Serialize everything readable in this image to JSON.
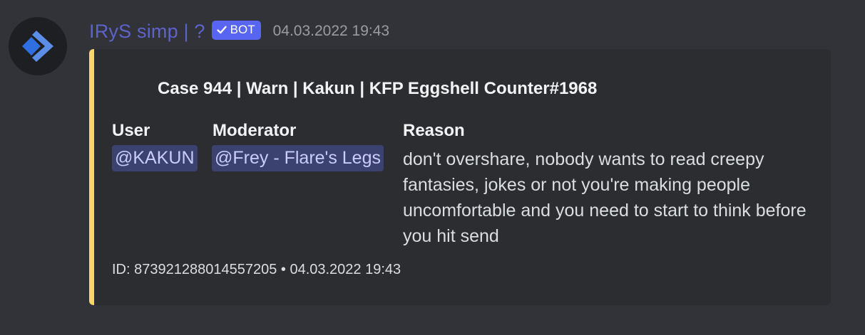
{
  "author": {
    "username": "IRyS simp | ?",
    "badge_label": "BOT",
    "timestamp": "04.03.2022 19:43",
    "avatar_icon": "chevron-right-diamond-icon"
  },
  "embed": {
    "accent_color": "#f8d864",
    "title": "Case 944 | Warn | Kakun | KFP Eggshell Counter#1968",
    "fields": {
      "user": {
        "name": "User",
        "value": "@KAKUN"
      },
      "moderator": {
        "name": "Moderator",
        "value": "@Frey - Flare's Legs"
      },
      "reason": {
        "name": "Reason",
        "value": "don't overshare, nobody wants to read creepy fantasies, jokes or not you're making people uncomfortable and you need to start to think before you hit send"
      }
    },
    "footer": "ID: 873921288014557205 • 04.03.2022 19:43"
  },
  "colors": {
    "background": "#313338",
    "embed_background": "#2b2d31",
    "mention_background": "#3c4270",
    "bot_badge": "#5865f2"
  }
}
